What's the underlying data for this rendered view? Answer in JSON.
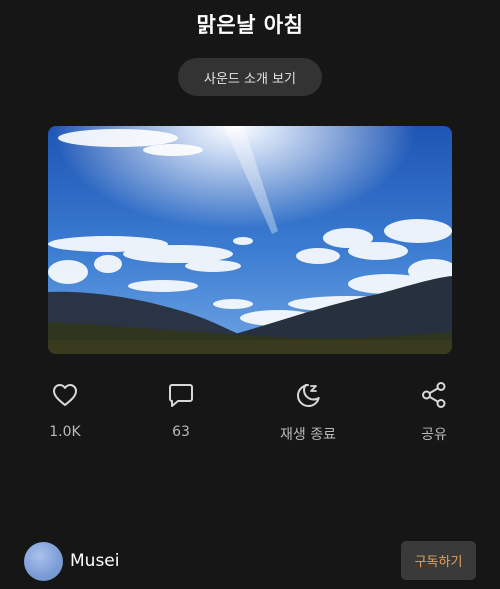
{
  "header": {
    "title": "맑은날 아침"
  },
  "intro_button": {
    "label": "사운드 소개 보기"
  },
  "cover": {
    "icon": "landscape-image",
    "colors": {
      "sky_top": "#1e55b4",
      "sky_bottom": "#6fa4e4",
      "mountain": "#2a3444",
      "ground": "#2f351e"
    }
  },
  "actions": {
    "like": {
      "icon": "heart-icon",
      "label": "1.0K"
    },
    "comment": {
      "icon": "speech-bubble-icon",
      "label": "63"
    },
    "sleep": {
      "icon": "moon-zz-icon",
      "label": "재생 종료"
    },
    "share": {
      "icon": "share-icon",
      "label": "공유"
    }
  },
  "creator": {
    "name": "Musei",
    "subscribe_label": "구독하기"
  },
  "colors": {
    "background": "#161616",
    "accent": "#e0a060",
    "icon": "#d8d8d8"
  }
}
